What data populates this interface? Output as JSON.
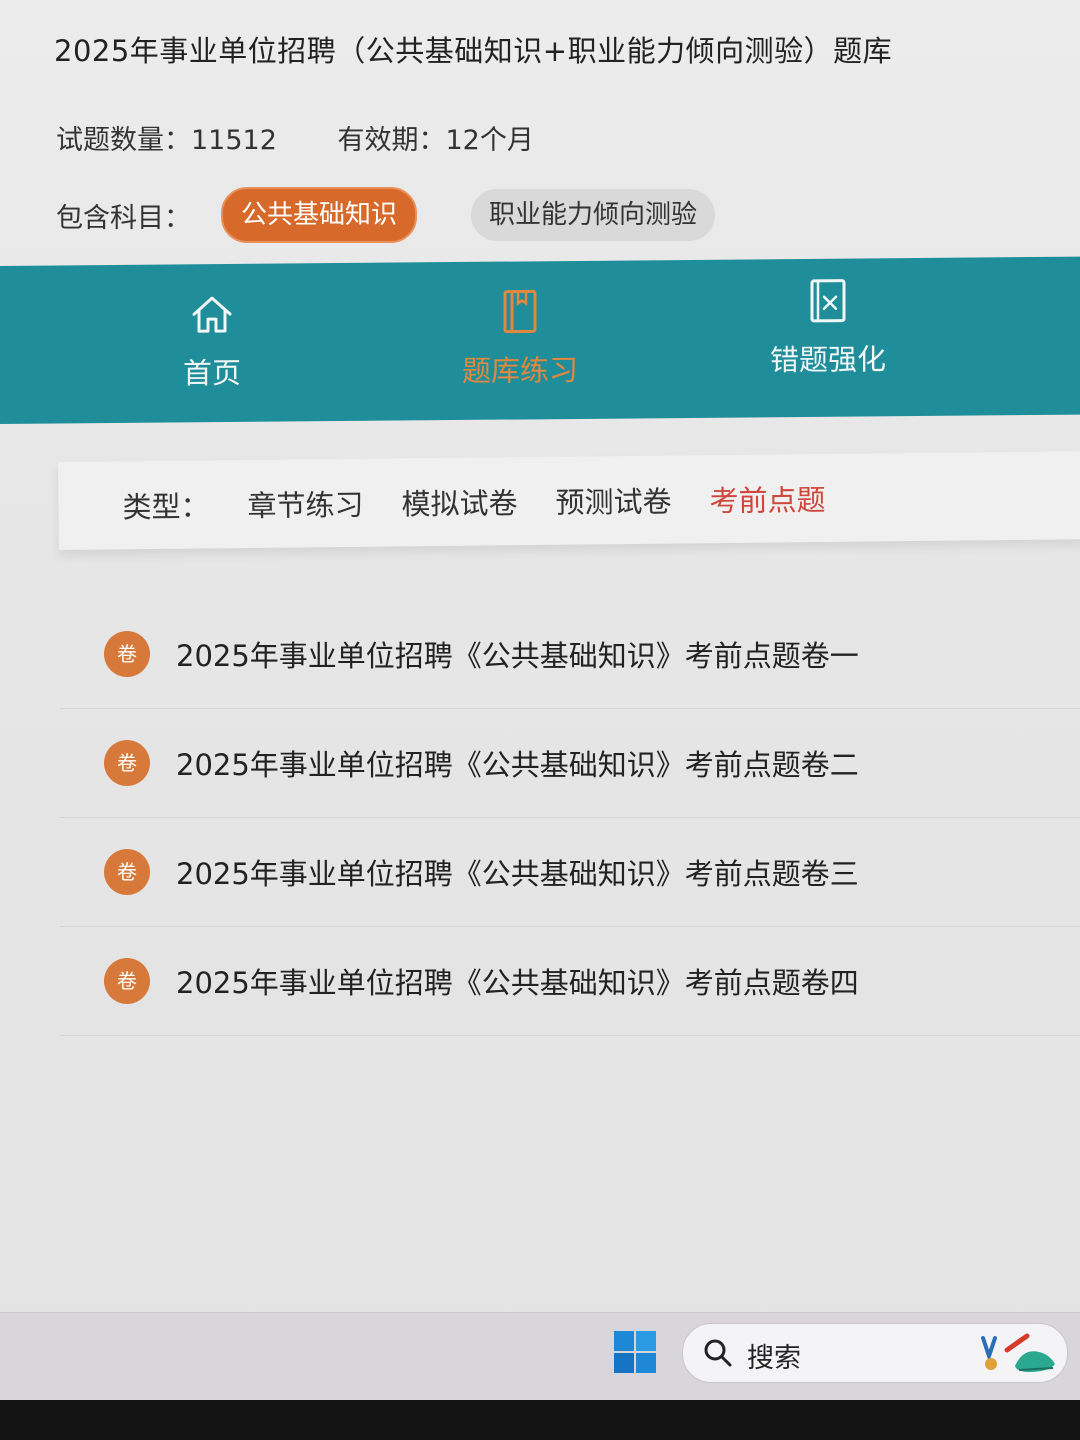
{
  "course": {
    "title": "2025年事业单位招聘（公共基础知识+职业能力倾向测验）题库",
    "question_count": "试题数量：11512",
    "validity": "有效期：12个月",
    "subjects_label": "包含科目：",
    "subjects": [
      {
        "label": "公共基础知识",
        "active": true
      },
      {
        "label": "职业能力倾向测验",
        "active": false
      }
    ]
  },
  "nav": {
    "items": [
      {
        "label": "首页",
        "icon": "home-icon",
        "active": false
      },
      {
        "label": "题库练习",
        "icon": "book-icon",
        "active": true
      },
      {
        "label": "错题强化",
        "icon": "wrong-question-icon",
        "active": false
      }
    ]
  },
  "types": {
    "label": "类型：",
    "tabs": [
      {
        "label": "章节练习",
        "active": false
      },
      {
        "label": "模拟试卷",
        "active": false
      },
      {
        "label": "预测试卷",
        "active": false
      },
      {
        "label": "考前点题",
        "active": true
      }
    ]
  },
  "papers": [
    {
      "badge": "卷",
      "title": "2025年事业单位招聘《公共基础知识》考前点题卷一"
    },
    {
      "badge": "卷",
      "title": "2025年事业单位招聘《公共基础知识》考前点题卷二"
    },
    {
      "badge": "卷",
      "title": "2025年事业单位招聘《公共基础知识》考前点题卷三"
    },
    {
      "badge": "卷",
      "title": "2025年事业单位招聘《公共基础知识》考前点题卷四"
    }
  ],
  "taskbar": {
    "search_label": "搜索",
    "start_icon": "windows-start-icon",
    "search_icon": "search-icon"
  },
  "colors": {
    "accent_orange": "#d76a2a",
    "nav_teal": "#1f8e9a",
    "active_tab_red": "#d0463a"
  }
}
